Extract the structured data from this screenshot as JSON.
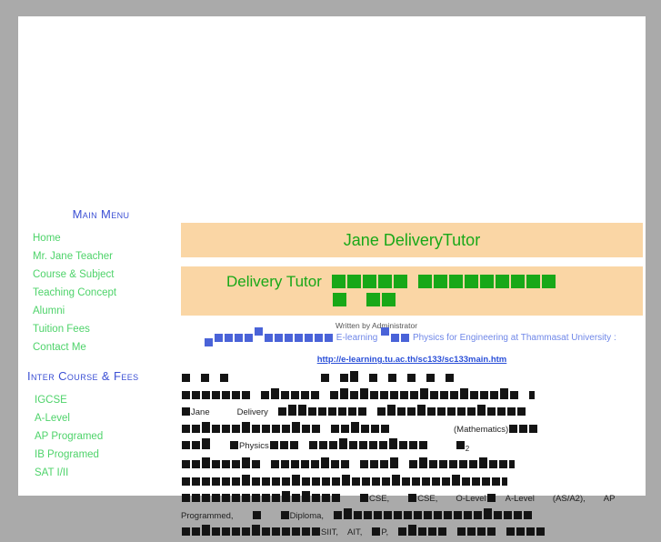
{
  "site": {
    "background_color": "#aaaaaa",
    "page_background": "#ffffff",
    "banner_color": "#fad6a5",
    "green": "#18a818",
    "link_green": "#4ed36a",
    "heading_blue": "#3b4fd4",
    "blue_text": "#6f87e8"
  },
  "sidebar": {
    "main_menu": {
      "heading": "Main Menu",
      "items": [
        {
          "label": "Home"
        },
        {
          "label": "Mr. Jane Teacher"
        },
        {
          "label": "Course & Subject"
        },
        {
          "label": "Teaching Concept"
        },
        {
          "label": "Alumni"
        },
        {
          "label": "Tuition Fees"
        },
        {
          "label": "Contact Me"
        }
      ]
    },
    "inter_menu": {
      "heading": "Inter Course & Fees",
      "items": [
        {
          "label": "IGCSE"
        },
        {
          "label": "A-Level"
        },
        {
          "label": "AP Programed"
        },
        {
          "label": "IB Programed"
        },
        {
          "label": "SAT I/II"
        }
      ]
    }
  },
  "main": {
    "banner_title": "Jane DeliveryTutor",
    "banner_subtitle_prefix": "Delivery Tutor",
    "byline": "Written by Administrator",
    "elearning_label": "E-learning",
    "elearning_tail": "Physics for Engineering at Thammasat University :",
    "url": "http://e-learning.tu.ac.th/sc133/sc133main.htm",
    "body_fragments": {
      "jane": "Jane",
      "delivery": "Delivery",
      "tutor": "Tutor",
      "physics": "Physics",
      "mathematics": "(Mathematics)",
      "subscript_two": "2",
      "igcse": "CSE,",
      "gcse": "CSE,",
      "olevel": "O-Level",
      "alevel": "A-Level",
      "as_a2": "(AS/A2),",
      "ap": "AP",
      "programmed": "Programmed,",
      "diploma": "Diploma,",
      "siit": "SIIT,",
      "ait": "AIT,",
      "tep": "P,"
    }
  }
}
